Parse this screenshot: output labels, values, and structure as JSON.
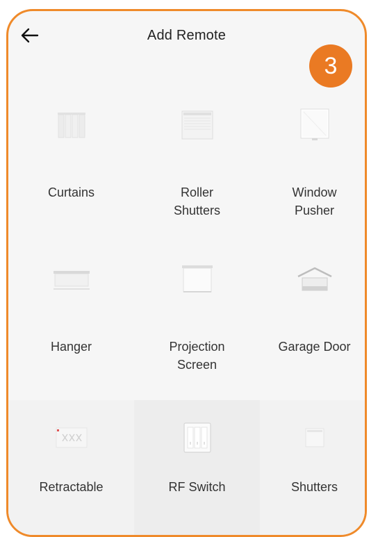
{
  "header": {
    "title": "Add Remote",
    "back_icon": "arrow-left-icon"
  },
  "badge": {
    "step": "3",
    "color": "#ea7a23"
  },
  "frame_color": "#ef8a2a",
  "tiles": [
    {
      "label": "Curtains",
      "icon": "curtains-icon"
    },
    {
      "label": "Roller\nShutters",
      "icon": "roller-shutters-icon"
    },
    {
      "label": "Window\nPusher",
      "icon": "window-pusher-icon"
    },
    {
      "label": "Hanger",
      "icon": "hanger-icon"
    },
    {
      "label": "Projection\nScreen",
      "icon": "projection-screen-icon"
    },
    {
      "label": "Garage Door",
      "icon": "garage-door-icon"
    },
    {
      "label": "Retractable",
      "icon": "retractable-icon"
    },
    {
      "label": "RF Switch",
      "icon": "rf-switch-icon"
    },
    {
      "label": "Shutters",
      "icon": "shutters-icon"
    }
  ]
}
